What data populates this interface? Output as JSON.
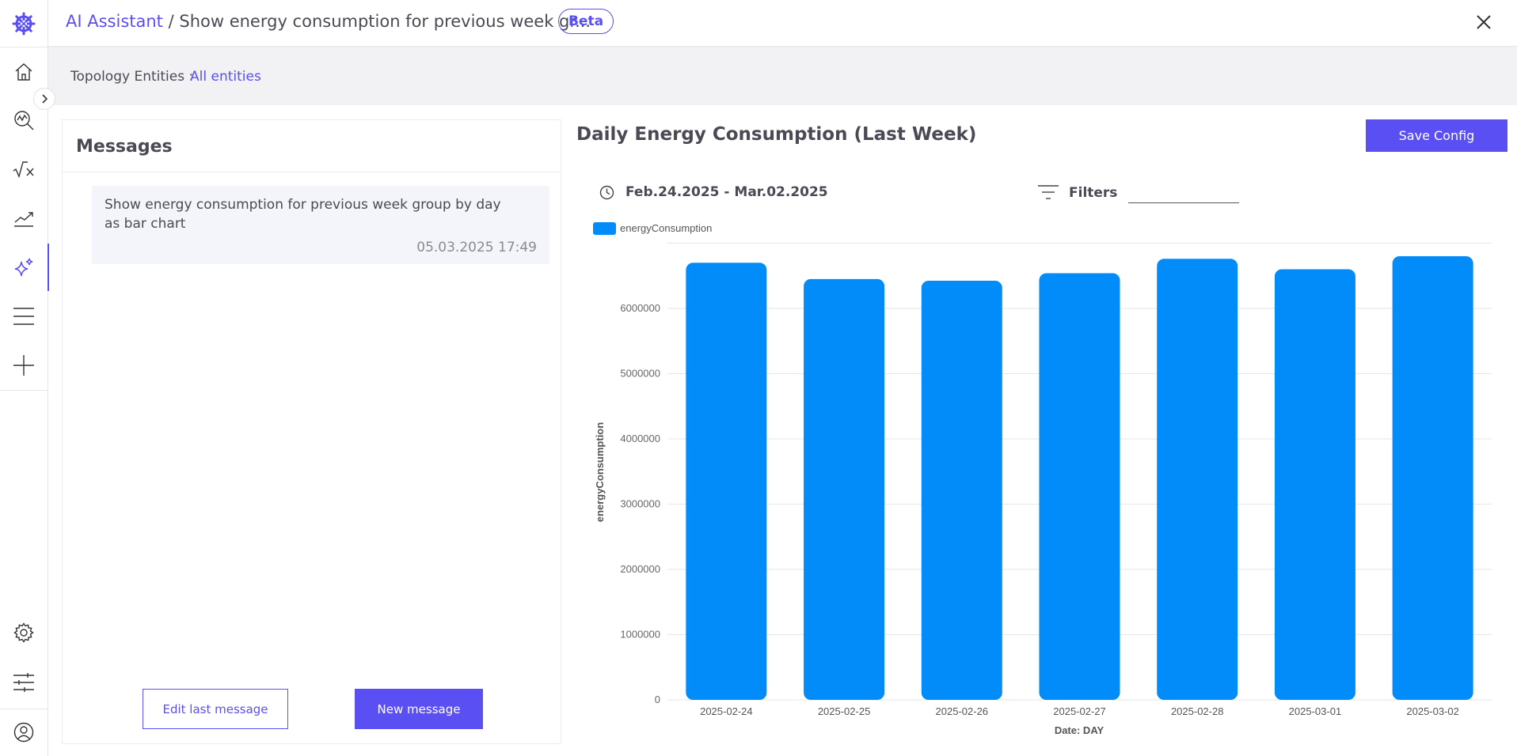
{
  "header": {
    "breadcrumb_link": "AI Assistant",
    "breadcrumb_separator": "/",
    "breadcrumb_current": "Show energy consumption for previous week gr...",
    "badge": "Beta"
  },
  "topology": {
    "label": "Topology Entities :",
    "value": "All entities"
  },
  "messages": {
    "title": "Messages",
    "items": [
      {
        "text": "Show energy consumption for previous week group by day as bar chart",
        "time": "05.03.2025 17:49"
      }
    ],
    "edit_label": "Edit last message",
    "new_label": "New message"
  },
  "panel": {
    "title": "Daily Energy Consumption (Last Week)",
    "save_label": "Save Config",
    "date_range": "Feb.24.2025 - Mar.02.2025",
    "filters_label": "Filters"
  },
  "sidebar": {
    "items": [
      "home",
      "search-analytics",
      "formula",
      "trend",
      "ai-assistant",
      "list",
      "add"
    ],
    "bottom": [
      "settings",
      "sliders",
      "user"
    ]
  },
  "colors": {
    "accent": "#5a4ff2",
    "bar": "#028cfa"
  },
  "chart_data": {
    "type": "bar",
    "categories": [
      "2025-02-24",
      "2025-02-25",
      "2025-02-26",
      "2025-02-27",
      "2025-02-28",
      "2025-03-01",
      "2025-03-02"
    ],
    "series": [
      {
        "name": "energyConsumption",
        "values": [
          6700000,
          6450000,
          6425000,
          6540000,
          6760000,
          6600000,
          6800000
        ]
      }
    ],
    "xlabel": "Date: DAY",
    "ylabel": "energyConsumption",
    "ylim": [
      0,
      7000000
    ],
    "yticks": [
      0,
      1000000,
      2000000,
      3000000,
      4000000,
      5000000,
      6000000
    ],
    "legend": "top-left",
    "grid": true
  }
}
